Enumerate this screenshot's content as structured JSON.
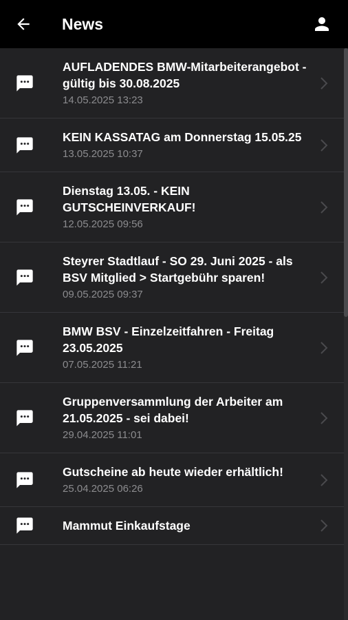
{
  "header": {
    "title": "News",
    "back_icon": "arrow-left-icon",
    "profile_icon": "person-icon"
  },
  "colors": {
    "topbar": "#000000",
    "background": "#222224",
    "headline": "#ffffff",
    "date": "#8c8c8f",
    "divider": "#36363a"
  },
  "news": [
    {
      "title": "AUFLADENDES BMW-Mitarbeiterangebot - gültig bis 30.08.2025",
      "date": "14.05.2025 13:23",
      "icon": "chat-bubble-icon"
    },
    {
      "title": "KEIN KASSATAG am Donnerstag 15.05.25",
      "date": "13.05.2025 10:37",
      "icon": "chat-bubble-icon"
    },
    {
      "title": "Dienstag 13.05. - KEIN GUTSCHEINVERKAUF!",
      "date": "12.05.2025 09:56",
      "icon": "chat-bubble-icon"
    },
    {
      "title": "Steyrer Stadtlauf - SO 29. Juni 2025 - als BSV Mitglied > Startgebühr sparen!",
      "date": "09.05.2025 09:37",
      "icon": "chat-bubble-icon"
    },
    {
      "title": "BMW BSV - Einzelzeitfahren - Freitag 23.05.2025",
      "date": "07.05.2025 11:21",
      "icon": "chat-bubble-icon"
    },
    {
      "title": "Gruppenversammlung der Arbeiter am 21.05.2025 - sei dabei!",
      "date": "29.04.2025 11:01",
      "icon": "chat-bubble-icon"
    },
    {
      "title": "Gutscheine ab heute wieder erhältlich!",
      "date": "25.04.2025 06:26",
      "icon": "chat-bubble-icon"
    },
    {
      "title": "Mammut Einkaufstage",
      "date": "",
      "icon": "chat-bubble-icon"
    }
  ]
}
